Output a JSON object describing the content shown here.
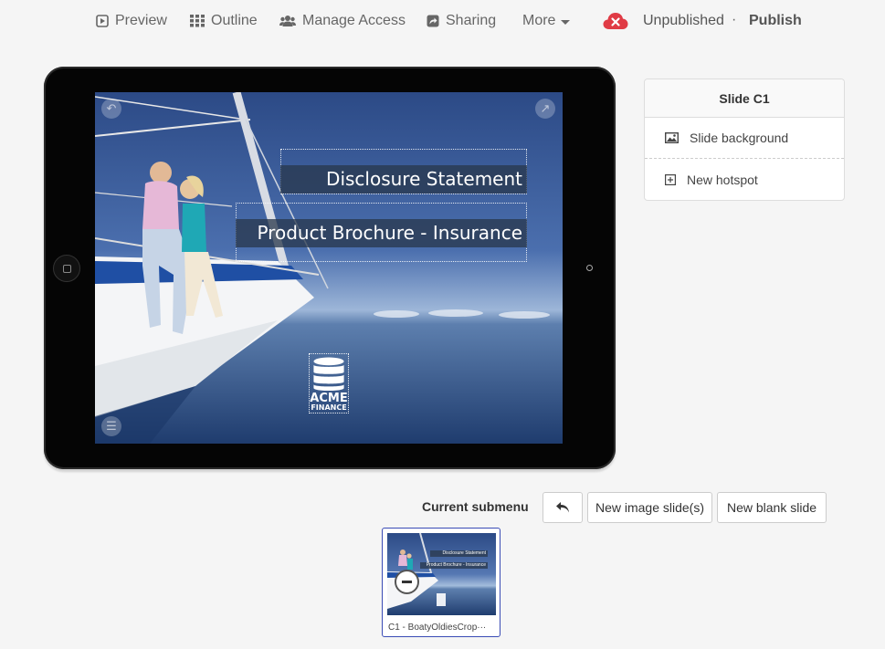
{
  "nav": {
    "preview": "Preview",
    "outline": "Outline",
    "manage_access": "Manage Access",
    "sharing": "Sharing",
    "more": "More",
    "status": "Unpublished",
    "separator": "·",
    "publish": "Publish"
  },
  "slide": {
    "title_1": "Disclosure Statement",
    "title_2": "Product Brochure - Insurance",
    "logo_line_1": "ACME",
    "logo_line_2": "FINANCE"
  },
  "panel": {
    "header": "Slide C1",
    "background_label": "Slide background",
    "hotspot_label": "New hotspot"
  },
  "toolbar": {
    "submenu_label": "Current submenu",
    "new_image": "New image slide(s)",
    "new_blank": "New blank slide"
  },
  "thumbnail": {
    "caption": "C1 - BoatyOldiesCrop···",
    "title_1": "Disclosure Statement",
    "title_2": "Product Brochure - Insurance"
  },
  "colors": {
    "accent": "#3a4bb5",
    "alert": "#e03b45"
  },
  "icons": {
    "preview": "play-square-icon",
    "outline": "grid-icon",
    "manage_access": "users-icon",
    "sharing": "share-icon",
    "status": "cloud-x-icon",
    "background": "image-icon",
    "hotspot": "plus-square-icon",
    "undo": "undo-icon"
  }
}
